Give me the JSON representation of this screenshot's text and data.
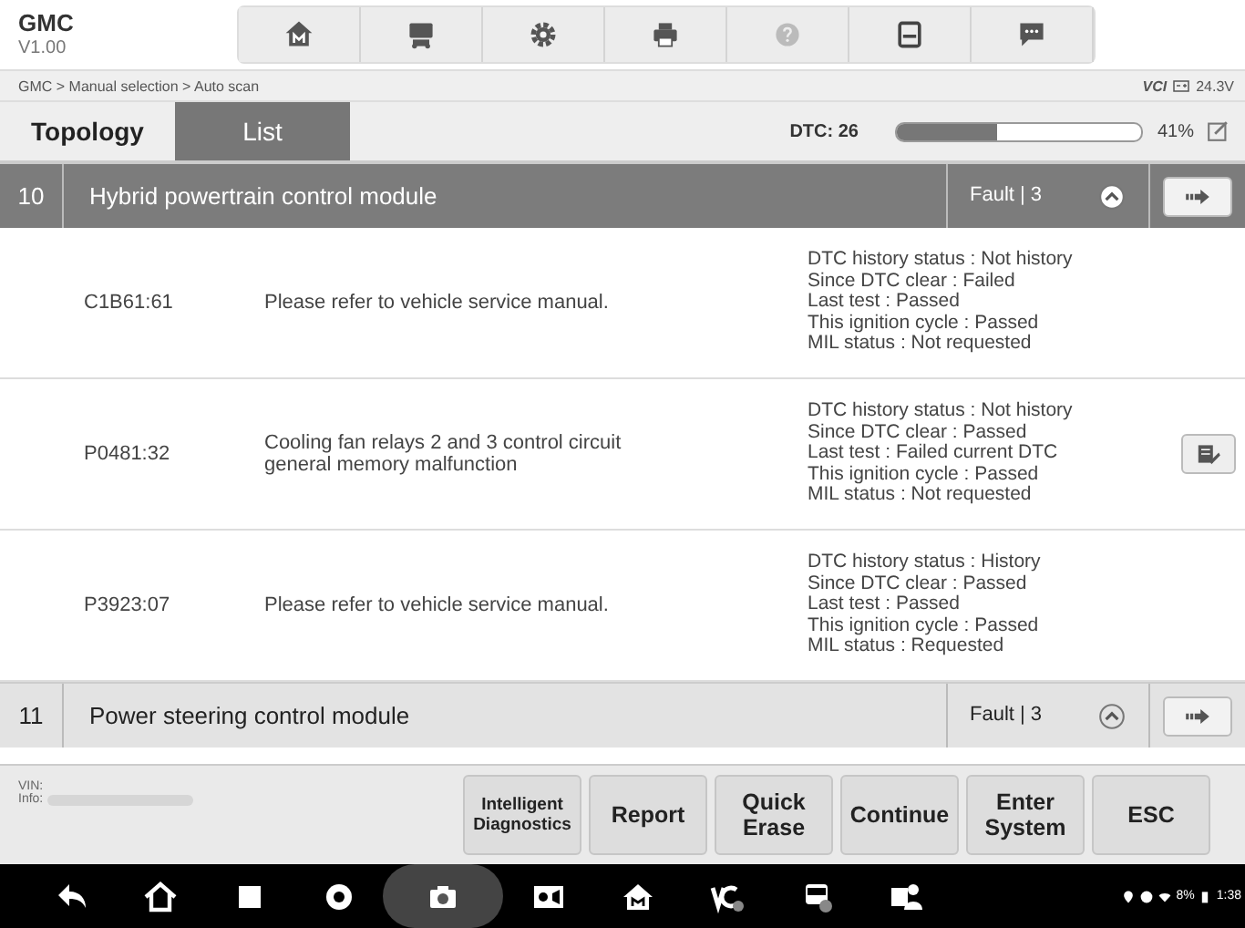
{
  "app": {
    "title": "GMC",
    "version": "V1.00"
  },
  "breadcrumb": "GMC > Manual selection > Auto scan",
  "vci": {
    "label": "VCI",
    "voltage": "24.3V"
  },
  "tabs": [
    {
      "label": "Topology",
      "selected": false
    },
    {
      "label": "List",
      "selected": true
    }
  ],
  "dtc_count": "DTC: 26",
  "progress": {
    "level": 0.41,
    "reading": "41%"
  },
  "modules": [
    {
      "number": "10",
      "name": "Hybrid powertrain control module",
      "status": "Fault | 3",
      "selected": true,
      "expanded": true,
      "codes": [
        {
          "code": "C1B61:61",
          "description": "Please refer to vehicle service manual.",
          "details": [
            "DTC history status : Not history",
            "Since DTC clear : Failed",
            "Last test : Passed",
            "This ignition cycle : Passed",
            "MIL status : Not requested"
          ],
          "help_button": false
        },
        {
          "code": "P0481:32",
          "description": "Cooling fan relays 2 and 3 control circuit general memory malfunction",
          "details": [
            "DTC history status : Not history",
            "Since DTC clear : Passed",
            "Last test : Failed current DTC",
            "This ignition cycle : Passed",
            "MIL status : Not requested"
          ],
          "help_button": true
        },
        {
          "code": "P3923:07",
          "description": "Please refer to vehicle service manual.",
          "details": [
            "DTC history status : History",
            "Since DTC clear : Passed",
            "Last test : Passed",
            "This ignition cycle : Passed",
            "MIL status : Requested"
          ],
          "help_button": false
        }
      ]
    },
    {
      "number": "11",
      "name": "Power steering control module",
      "status": "Fault | 3",
      "selected": false,
      "expanded": true
    }
  ],
  "vehicle_info": {
    "vin_label": "VIN:",
    "info_label": "Info:"
  },
  "buttons": [
    "Intelligent Diagnostics",
    "Report",
    "Quick Erase",
    "Continue",
    "Enter System",
    "ESC"
  ],
  "status": {
    "battery": "8%",
    "time": "1:38"
  }
}
